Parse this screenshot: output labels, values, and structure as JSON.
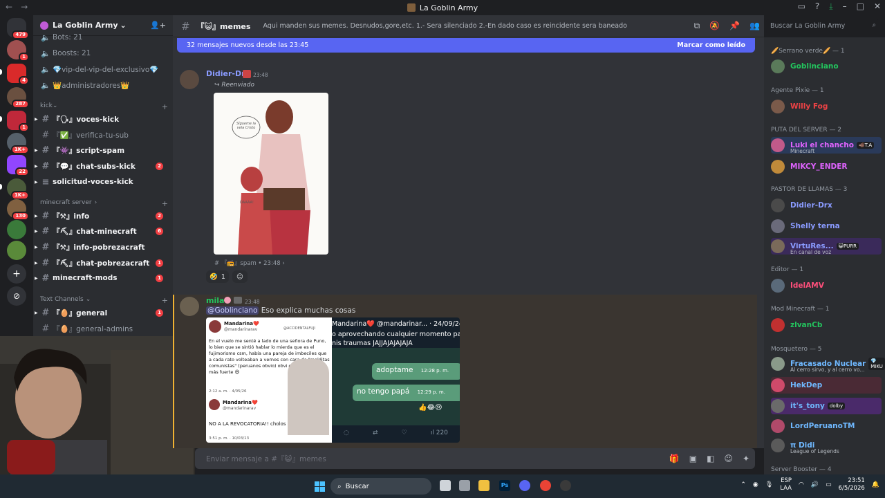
{
  "window": {
    "title": "La Goblin Army"
  },
  "server": {
    "name": "La Goblin Army"
  },
  "guild_badges": [
    "479",
    "1",
    "4",
    "287",
    "1",
    "1K+",
    "22",
    "1K+",
    "130"
  ],
  "channels": {
    "top": [
      {
        "label": "Bots: 21"
      },
      {
        "label": "Boosts: 21"
      },
      {
        "label": "💎vip-del-vip-del-exclusivo💎"
      },
      {
        "label": "👑administradores👑"
      }
    ],
    "cat_kick": "kick",
    "kick": [
      {
        "label": "『🗣』voces-kick",
        "unread": true,
        "badge": ""
      },
      {
        "label": "『✅』verifica-tu-sub",
        "unread": false,
        "badge": ""
      },
      {
        "label": "『👾』script-spam",
        "unread": true,
        "badge": ""
      },
      {
        "label": "『💬』chat-subs-kick",
        "unread": true,
        "badge": "2"
      },
      {
        "label": "solicitud-voces-kick",
        "unread": true,
        "badge": ""
      }
    ],
    "cat_mc": "minecraft server",
    "mc": [
      {
        "label": "『⚒』info",
        "badge": "2"
      },
      {
        "label": "『⛏』chat-minecraft",
        "badge": "6"
      },
      {
        "label": "『⚒』info-pobrezacraft",
        "badge": ""
      },
      {
        "label": "『⛏』chat-pobrezacraft",
        "badge": "1"
      },
      {
        "label": "minecraft-mods",
        "badge": "1"
      }
    ],
    "cat_text": "Text Channels",
    "text": [
      {
        "label": "『🥚』general",
        "badge": "1",
        "unread": true
      },
      {
        "label": "『🥚』general-admins",
        "badge": "",
        "unread": false
      }
    ]
  },
  "header": {
    "channel": "『😺』memes",
    "topic": "Aqui manden sus memes. Desnudos,gore,etc. 1.- Sera silenciado 2.-En dado caso es reincidente sera baneado",
    "search_placeholder": "Buscar La Goblin Army"
  },
  "banner": {
    "text": "32 mensajes nuevos desde las 23:45",
    "action": "Marcar como leído"
  },
  "messages": {
    "m1": {
      "author": "Didier-Drx",
      "time": "23:48",
      "forwarded": "Reenviado",
      "image_text": "Sígueme la vela Cristo",
      "image_text2": "DAAAA!",
      "source": "『📻』spam • 23:48",
      "reaction_count": "1"
    },
    "m2": {
      "author": "mila",
      "time": "23:48",
      "mention": "@Goblinciano",
      "text": "Eso explica muchas cosas",
      "tw1_name": "Mandarina❤️",
      "tw1_handle": "@mandarinarav",
      "tw1_handle2": "@ACCIDENTALFUJI",
      "tw1_body": "En el vuelo me senté a lado de una señora de Puno, lo bien que se sintió hablar lo mierda que es el fujimorismo csm, había una pareja de imbeciles que a cada rato volteaban a vernos con cara de \"malditas comunistas\" (peruanos obvio) obvi empecé a hablar más fuerte 😆",
      "tw1_time": "2:12 a. m. · 4/05/26",
      "tw1b_body": "NO A LA REVOCATORIA!! cholos de mierda!",
      "tw1b_time": "3:51 p. m. · 10/03/13",
      "tw2_head": "Mandarina❤️ @mandarinar... · 24/09/24",
      "tw2_body": "o aprovechando cualquier momento pa\nnis traumas JAJJAJAJAJAJA",
      "bubble1": "adoptame",
      "bubble1_time": "12:28 p. m.",
      "bubble2": "no tengo papá",
      "bubble2_time": "12:29 p. m.",
      "views": "220"
    }
  },
  "input": {
    "placeholder": "Enviar mensaje a #『😺』memes"
  },
  "members": [
    {
      "role": "🥖Serrano verde🥖 — 1"
    },
    {
      "name": "Goblinciano",
      "color": "#23c55e"
    },
    {
      "role": "Agente Pixie — 1"
    },
    {
      "name": "Willy Fog",
      "color": "#ed4245"
    },
    {
      "role": "PUTA DEL SERVER — 2"
    },
    {
      "name": "Luki el chancho",
      "color": "#e063ff",
      "tag": "🐗T.A",
      "status": "Minecraft"
    },
    {
      "name": "MIKCY_ENDER",
      "color": "#e063ff"
    },
    {
      "role": "PASTOR DE LLAMAS — 3"
    },
    {
      "name": "Didier-Drx",
      "color": "#8a9bff"
    },
    {
      "name": "Shelly terna",
      "color": "#8a9bff"
    },
    {
      "name": "VirtuRes...",
      "color": "#8a9bff",
      "tag": "😺PURR",
      "status": "En canal de voz"
    },
    {
      "role": "Editor — 1"
    },
    {
      "name": "IdelAMV",
      "color": "#ff4f7b"
    },
    {
      "role": "Mod Minecraft — 1"
    },
    {
      "name": "zlvanCb",
      "color": "#23c55e"
    },
    {
      "role": "Mosquetero — 5"
    },
    {
      "name": "Fracasado Nuclear",
      "color": "#6fb8ff",
      "tag": "💎MIKU",
      "status": "Al cerro sirvo, y al cerro vo..."
    },
    {
      "name": "HekDep",
      "color": "#6fb8ff"
    },
    {
      "name": "it's_tony",
      "color": "#6fb8ff",
      "tag": "dolby"
    },
    {
      "name": "LordPeruanoTM",
      "color": "#6fb8ff"
    },
    {
      "name": "π Didi",
      "color": "#6fb8ff",
      "status": "League of Legends"
    },
    {
      "role": "Server Booster — 4"
    }
  ],
  "taskbar": {
    "search": "Buscar",
    "lang": "ESP",
    "lang2": "LAA",
    "time": "23:51",
    "date": "6/5/2026"
  }
}
